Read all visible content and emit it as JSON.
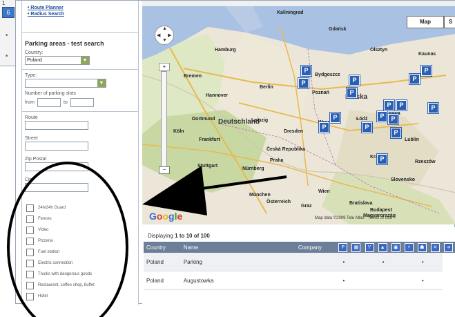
{
  "background_page": {
    "number": "1",
    "icon_label": "6"
  },
  "nav_links": [
    "Route Planner",
    "Radius Search"
  ],
  "search": {
    "title": "Parking areas - test search",
    "country_label": "Country:",
    "country_value": "Poland",
    "type_label": "Type:",
    "type_value": "",
    "slots_label": "Number of parking slots",
    "from_label": "from",
    "to_label": "to",
    "route_label": "Route",
    "street_label": "Street",
    "zip_label": "Zip Postal",
    "city_label": "City"
  },
  "amenities": [
    "24h/24h Guard",
    "Fences",
    "Video",
    "Pizzeria",
    "Fuel station",
    "Electric connection",
    "Trucks with dangerous goods",
    "Restaurant, coffee shop, buffet",
    "Hotel"
  ],
  "map": {
    "type_button": "Map",
    "type_button_more": "S",
    "zoom_in": "+",
    "zoom_out": "−",
    "copyright": "Map data ©2009 Tele Atlas · Terms of Use",
    "google": [
      "G",
      "o",
      "o",
      "g",
      "l",
      "e"
    ],
    "countries": [
      "Deutschland",
      "Polska",
      "Česká Republika",
      "Slovensko"
    ],
    "cities": [
      "Kaliningrad",
      "Gdańsk",
      "Bydgoszcz",
      "Olsztyn",
      "Hamburg",
      "Bremen",
      "Hannover",
      "Berlin",
      "Poznań",
      "Warszawa",
      "Leipzig",
      "Dresden",
      "Wrocław",
      "Łódź",
      "Lublin",
      "Kraków",
      "Praha",
      "Nürnberg",
      "Frankfurt",
      "Stuttgart",
      "München",
      "Wien",
      "Bratislava",
      "Budapest",
      "Dortmund",
      "Köln",
      "Kaunas",
      "Rzeszów",
      "Graz",
      "Magyarország",
      "Österreich"
    ],
    "marker_letter": "P"
  },
  "results": {
    "display_prefix": "Displaying",
    "display_range": "1 to 10 of 100",
    "columns": [
      "Country",
      "Name",
      "Company"
    ],
    "rows": [
      {
        "country": "Poland",
        "name": "Parking",
        "marks": [
          "•",
          "•",
          "•"
        ]
      },
      {
        "country": "Poland",
        "name": "Augustowka",
        "marks": [
          "•",
          "",
          "•"
        ]
      }
    ],
    "icon_columns": [
      "P",
      "▦",
      "Y",
      "▲",
      "▣",
      "⚡",
      "☗",
      "✕",
      "➔"
    ]
  },
  "colors": {
    "table_header": "#6d7f98",
    "marker_blue": "#2a5fb4",
    "link_blue": "#1c4f9c",
    "select_arrow_green": "#8fa65f",
    "annotation": "#000000"
  }
}
